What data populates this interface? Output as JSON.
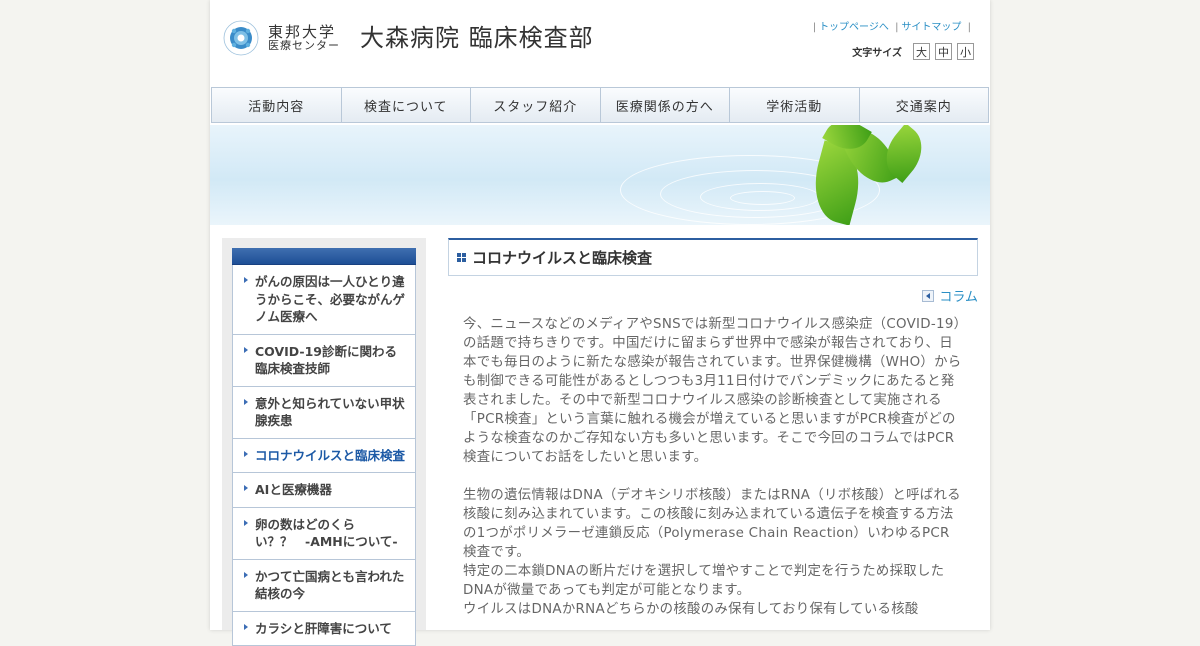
{
  "header": {
    "logo_university": "東邦大学",
    "logo_center": "医療センター",
    "site_title": "大森病院 臨床検査部",
    "links": [
      "トップページへ",
      "サイトマップ"
    ],
    "font_size_label": "文字サイズ",
    "font_size_options": [
      "大",
      "中",
      "小"
    ]
  },
  "nav": [
    "活動内容",
    "検査について",
    "スタッフ紹介",
    "医療関係の方へ",
    "学術活動",
    "交通案内"
  ],
  "sidebar": {
    "items": [
      {
        "label": "がんの原因は一人ひとり違うからこそ、必要ながんゲノム医療へ"
      },
      {
        "label": "COVID-19診断に関わる臨床検査技師"
      },
      {
        "label": "意外と知られていない甲状腺疾患"
      },
      {
        "label": "コロナウイルスと臨床検査"
      },
      {
        "label": "AIと医療機器"
      },
      {
        "label": "卵の数はどのくらい？？　-AMHについて-"
      },
      {
        "label": "かつて亡国病とも言われた結核の今"
      },
      {
        "label": "カラシと肝障害について"
      }
    ],
    "active_index": 3
  },
  "main": {
    "title": "コロナウイルスと臨床検査",
    "category": "コラム",
    "paragraphs": [
      "今、ニュースなどのメディアやSNSでは新型コロナウイルス感染症（COVID-19）の話題で持ちきりです。中国だけに留まらず世界中で感染が報告されており、日本でも毎日のように新たな感染が報告されています。世界保健機構（WHO）からも制御できる可能性があるとしつつも3月11日付けでパンデミックにあたると発表されました。その中で新型コロナウイルス感染の診断検査として実施される「PCR検査」という言葉に触れる機会が増えていると思いますがPCR検査がどのような検査なのかご存知ない方も多いと思います。そこで今回のコラムではPCR検査についてお話をしたいと思います。",
      "生物の遺伝情報はDNA（デオキシリボ核酸）またはRNA（リボ核酸）と呼ばれる核酸に刻み込まれています。この核酸に刻み込まれている遺伝子を検査する方法の1つがポリメラーゼ連鎖反応（Polymerase Chain Reaction）いわゆるPCR検査です。",
      "特定の二本鎖DNAの断片だけを選択して増やすことで判定を行うため採取したDNAが微量であっても判定が可能となります。",
      "ウイルスはDNAかRNAどちらかの核酸のみ保有しており保有している核酸"
    ]
  },
  "colors": {
    "link": "#2a8fc5",
    "accent_blue": "#2c5ea0",
    "active_sidebar": "#1d5aa6"
  }
}
